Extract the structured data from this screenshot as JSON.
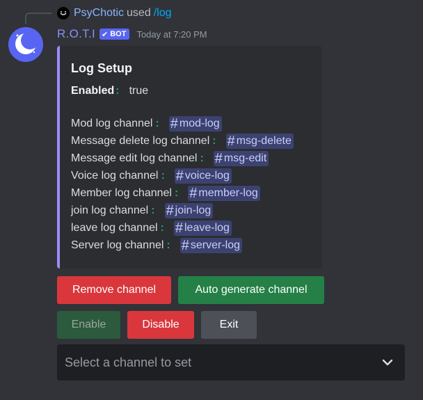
{
  "reply": {
    "user": "PsyChotic",
    "used": "used",
    "command": "/log"
  },
  "message": {
    "author": "R.O.T.I",
    "badge": "BOT",
    "timestamp": "Today at 7:20 PM"
  },
  "embed": {
    "accent_color": "#9b8ef5",
    "title": "Log Setup",
    "enabled_label": "Enabled",
    "enabled_value": "true",
    "fields": [
      {
        "label": "Mod log channel",
        "channel": "mod-log"
      },
      {
        "label": "Message delete log channel",
        "channel": "msg-delete"
      },
      {
        "label": "Message edit log channel",
        "channel": "msg-edit"
      },
      {
        "label": "Voice log channel",
        "channel": "voice-log"
      },
      {
        "label": "Member log channel",
        "channel": "member-log"
      },
      {
        "label": "join log channel",
        "channel": "join-log"
      },
      {
        "label": "leave log channel",
        "channel": "leave-log"
      },
      {
        "label": "Server log channel",
        "channel": "server-log"
      }
    ]
  },
  "buttons": {
    "remove_channel": "Remove channel",
    "auto_generate": "Auto generate channel",
    "enable": "Enable",
    "disable": "Disable",
    "exit": "Exit"
  },
  "select": {
    "placeholder": "Select a channel to set"
  },
  "colors": {
    "background": "#313338",
    "danger": "#da373c",
    "success": "#248046",
    "secondary": "#4e5058",
    "blurple": "#5865f2"
  }
}
